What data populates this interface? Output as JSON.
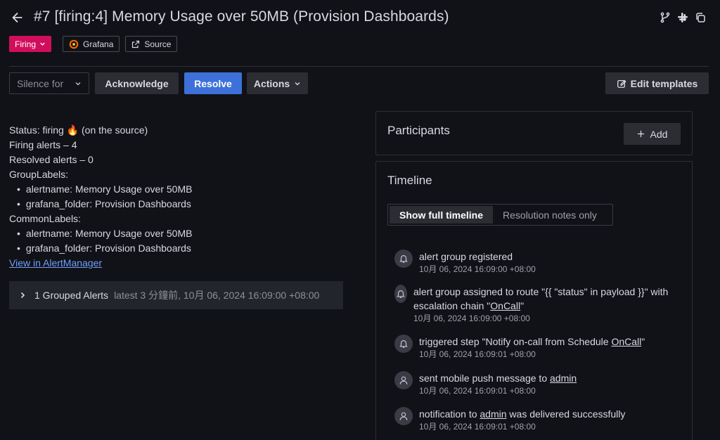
{
  "header": {
    "title": "#7 [firing:4] Memory Usage over 50MB (Provision Dashboards)",
    "status_badge": "Firing",
    "tags": [
      "Grafana",
      "Source"
    ]
  },
  "toolbar": {
    "silence_label": "Silence for",
    "acknowledge_label": "Acknowledge",
    "resolve_label": "Resolve",
    "actions_label": "Actions",
    "edit_templates_label": "Edit templates"
  },
  "details": {
    "status_line": "Status: firing 🔥 (on the source)",
    "firing_alerts": "Firing alerts – 4",
    "resolved_alerts": "Resolved alerts – 0",
    "group_labels_title": "GroupLabels:",
    "group_labels": [
      "alertname: Memory Usage over 50MB",
      "grafana_folder: Provision Dashboards"
    ],
    "common_labels_title": "CommonLabels:",
    "common_labels": [
      "alertname: Memory Usage over 50MB",
      "grafana_folder: Provision Dashboards"
    ],
    "alertmanager_link": "View in AlertManager"
  },
  "grouped_alerts": {
    "label": "1 Grouped Alerts",
    "latest": "latest 3 分鐘前, 10月 06, 2024 16:09:00 +08:00"
  },
  "participants": {
    "title": "Participants",
    "add_label": "Add"
  },
  "timeline": {
    "title": "Timeline",
    "toggle_full": "Show full timeline",
    "toggle_notes": "Resolution notes only",
    "items": [
      {
        "icon": "bell-icon",
        "text_pre": "alert group registered",
        "link": "",
        "text_post": "",
        "time": "10月 06, 2024 16:09:00 +08:00"
      },
      {
        "icon": "bell-icon",
        "text_pre": "alert group assigned to route \"{{ \"status\" in payload }}\" with escalation chain \"",
        "link": "OnCall",
        "text_post": "\"",
        "time": "10月 06, 2024 16:09:00 +08:00"
      },
      {
        "icon": "bell-icon",
        "text_pre": "triggered step \"Notify on-call from Schedule ",
        "link": "OnCall",
        "text_post": "\"",
        "time": "10月 06, 2024 16:09:01 +08:00"
      },
      {
        "icon": "user-icon",
        "text_pre": "sent mobile push message to ",
        "link": "admin",
        "text_post": "",
        "time": "10月 06, 2024 16:09:01 +08:00"
      },
      {
        "icon": "user-icon",
        "text_pre": "notification to ",
        "link": "admin",
        "text_post": " was delivered successfully",
        "time": "10月 06, 2024 16:09:01 +08:00"
      }
    ]
  },
  "colors": {
    "background": "#111217",
    "firing": "#d10e5c",
    "primary": "#3d71d9",
    "link": "#6e9fff"
  }
}
